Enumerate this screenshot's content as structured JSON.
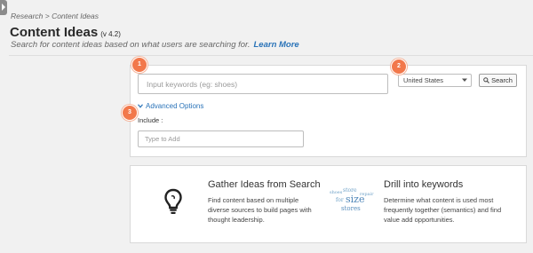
{
  "breadcrumb": "Research > Content Ideas",
  "page": {
    "title": "Content Ideas",
    "version": "(v 4.2)",
    "subtitle": "Search for content ideas based on what users are searching for.",
    "learn_more": "Learn More"
  },
  "search": {
    "keyword_placeholder": "Input keywords (eg: shoes)",
    "country": "United States",
    "search_label": "Search",
    "advanced_options": "Advanced Options",
    "include_label": "Include :",
    "include_placeholder": "Type to Add"
  },
  "badges": [
    "1",
    "2",
    "3"
  ],
  "features": [
    {
      "title": "Gather Ideas from Search",
      "description": "Find content based on multiple diverse sources to build pages with thought leadership.",
      "icon": "lightbulb-icon"
    },
    {
      "title": "Drill into keywords",
      "description": "Determine what content is used most frequently together (semantics) and find value add opportunities.",
      "icon": "word-cloud-icon",
      "cloud_words": [
        "store",
        "repair",
        "for",
        "size",
        "stores",
        "shoes"
      ]
    }
  ],
  "colors": {
    "accent": "#2a73b8",
    "badge": "#f2784b",
    "background": "#f1f1f1"
  }
}
